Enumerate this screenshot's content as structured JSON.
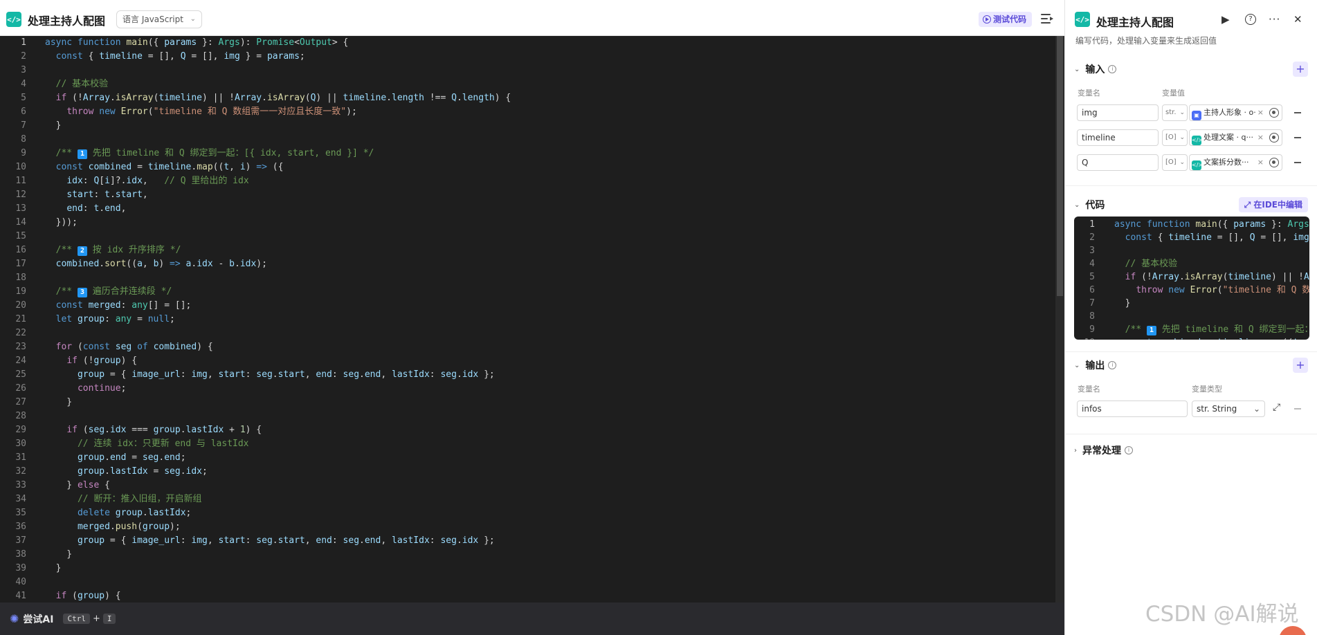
{
  "editor": {
    "title": "处理主持人配图",
    "language_label": "语言 JavaScript",
    "test_button": "测试代码",
    "lines": [
      [
        [
          "k",
          "async "
        ],
        [
          "k",
          "function "
        ],
        [
          "f",
          "main"
        ],
        [
          "p",
          "({ "
        ],
        [
          "v",
          "params "
        ],
        [
          "p",
          "}: "
        ],
        [
          "t",
          "Args"
        ],
        [
          "p",
          "): "
        ],
        [
          "t",
          "Promise"
        ],
        [
          "p",
          "<"
        ],
        [
          "t",
          "Output"
        ],
        [
          "p",
          "> {"
        ]
      ],
      [
        [
          "p",
          "  "
        ],
        [
          "k",
          "const "
        ],
        [
          "p",
          "{ "
        ],
        [
          "v",
          "timeline"
        ],
        [
          "p",
          " = [], "
        ],
        [
          "v",
          "Q"
        ],
        [
          "p",
          " = [], "
        ],
        [
          "v",
          "img "
        ],
        [
          "p",
          "} = "
        ],
        [
          "v",
          "params"
        ],
        [
          "p",
          ";"
        ]
      ],
      [
        [
          "p",
          ""
        ]
      ],
      [
        [
          "p",
          "  "
        ],
        [
          "c",
          "// 基本校验"
        ]
      ],
      [
        [
          "p",
          "  "
        ],
        [
          "cf",
          "if "
        ],
        [
          "p",
          "(!"
        ],
        [
          "v",
          "Array"
        ],
        [
          "p",
          "."
        ],
        [
          "f",
          "isArray"
        ],
        [
          "p",
          "("
        ],
        [
          "v",
          "timeline"
        ],
        [
          "p",
          ") || !"
        ],
        [
          "v",
          "Array"
        ],
        [
          "p",
          "."
        ],
        [
          "f",
          "isArray"
        ],
        [
          "p",
          "("
        ],
        [
          "v",
          "Q"
        ],
        [
          "p",
          ") || "
        ],
        [
          "v",
          "timeline"
        ],
        [
          "p",
          "."
        ],
        [
          "v",
          "length "
        ],
        [
          "p",
          "!== "
        ],
        [
          "v",
          "Q"
        ],
        [
          "p",
          "."
        ],
        [
          "v",
          "length"
        ],
        [
          "p",
          ") {"
        ]
      ],
      [
        [
          "p",
          "    "
        ],
        [
          "cf",
          "throw "
        ],
        [
          "k",
          "new "
        ],
        [
          "f",
          "Error"
        ],
        [
          "p",
          "("
        ],
        [
          "s",
          "\"timeline 和 Q 数组需一一对应且长度一致\""
        ],
        [
          "p",
          ");"
        ]
      ],
      [
        [
          "p",
          "  }"
        ]
      ],
      [
        [
          "p",
          ""
        ]
      ],
      [
        [
          "p",
          "  "
        ],
        [
          "c",
          "/** "
        ],
        [
          "e",
          "1"
        ],
        [
          "c",
          " 先把 timeline 和 Q 绑定到一起：[{ idx, start, end }] */"
        ]
      ],
      [
        [
          "p",
          "  "
        ],
        [
          "k",
          "const "
        ],
        [
          "v",
          "combined"
        ],
        [
          "p",
          " = "
        ],
        [
          "v",
          "timeline"
        ],
        [
          "p",
          "."
        ],
        [
          "f",
          "map"
        ],
        [
          "p",
          "(("
        ],
        [
          "v",
          "t"
        ],
        [
          "p",
          ", "
        ],
        [
          "v",
          "i"
        ],
        [
          "p",
          ") "
        ],
        [
          "k",
          "=>"
        ],
        [
          "p",
          " ({"
        ]
      ],
      [
        [
          "p",
          "    "
        ],
        [
          "v",
          "idx"
        ],
        [
          "p",
          ": "
        ],
        [
          "v",
          "Q"
        ],
        [
          "p",
          "["
        ],
        [
          "v",
          "i"
        ],
        [
          "p",
          "]?."
        ],
        [
          "v",
          "idx"
        ],
        [
          "p",
          ",   "
        ],
        [
          "c",
          "// Q 里给出的 idx"
        ]
      ],
      [
        [
          "p",
          "    "
        ],
        [
          "v",
          "start"
        ],
        [
          "p",
          ": "
        ],
        [
          "v",
          "t"
        ],
        [
          "p",
          "."
        ],
        [
          "v",
          "start"
        ],
        [
          "p",
          ","
        ]
      ],
      [
        [
          "p",
          "    "
        ],
        [
          "v",
          "end"
        ],
        [
          "p",
          ": "
        ],
        [
          "v",
          "t"
        ],
        [
          "p",
          "."
        ],
        [
          "v",
          "end"
        ],
        [
          "p",
          ","
        ]
      ],
      [
        [
          "p",
          "  }));"
        ]
      ],
      [
        [
          "p",
          ""
        ]
      ],
      [
        [
          "p",
          "  "
        ],
        [
          "c",
          "/** "
        ],
        [
          "e",
          "2"
        ],
        [
          "c",
          " 按 idx 升序排序 */"
        ]
      ],
      [
        [
          "p",
          "  "
        ],
        [
          "v",
          "combined"
        ],
        [
          "p",
          "."
        ],
        [
          "f",
          "sort"
        ],
        [
          "p",
          "(("
        ],
        [
          "v",
          "a"
        ],
        [
          "p",
          ", "
        ],
        [
          "v",
          "b"
        ],
        [
          "p",
          ") "
        ],
        [
          "k",
          "=>"
        ],
        [
          "p",
          " "
        ],
        [
          "v",
          "a"
        ],
        [
          "p",
          "."
        ],
        [
          "v",
          "idx"
        ],
        [
          "p",
          " - "
        ],
        [
          "v",
          "b"
        ],
        [
          "p",
          "."
        ],
        [
          "v",
          "idx"
        ],
        [
          "p",
          ");"
        ]
      ],
      [
        [
          "p",
          ""
        ]
      ],
      [
        [
          "p",
          "  "
        ],
        [
          "c",
          "/** "
        ],
        [
          "e",
          "3"
        ],
        [
          "c",
          " 遍历合并连续段 */"
        ]
      ],
      [
        [
          "p",
          "  "
        ],
        [
          "k",
          "const "
        ],
        [
          "v",
          "merged"
        ],
        [
          "p",
          ": "
        ],
        [
          "t",
          "any"
        ],
        [
          "p",
          "[] = [];"
        ]
      ],
      [
        [
          "p",
          "  "
        ],
        [
          "k",
          "let "
        ],
        [
          "v",
          "group"
        ],
        [
          "p",
          ": "
        ],
        [
          "t",
          "any"
        ],
        [
          "p",
          " = "
        ],
        [
          "k",
          "null"
        ],
        [
          "p",
          ";"
        ]
      ],
      [
        [
          "p",
          ""
        ]
      ],
      [
        [
          "p",
          "  "
        ],
        [
          "cf",
          "for "
        ],
        [
          "p",
          "("
        ],
        [
          "k",
          "const "
        ],
        [
          "v",
          "seg "
        ],
        [
          "k",
          "of "
        ],
        [
          "v",
          "combined"
        ],
        [
          "p",
          ") {"
        ]
      ],
      [
        [
          "p",
          "    "
        ],
        [
          "cf",
          "if "
        ],
        [
          "p",
          "(!"
        ],
        [
          "v",
          "group"
        ],
        [
          "p",
          ") {"
        ]
      ],
      [
        [
          "p",
          "      "
        ],
        [
          "v",
          "group"
        ],
        [
          "p",
          " = { "
        ],
        [
          "v",
          "image_url"
        ],
        [
          "p",
          ": "
        ],
        [
          "v",
          "img"
        ],
        [
          "p",
          ", "
        ],
        [
          "v",
          "start"
        ],
        [
          "p",
          ": "
        ],
        [
          "v",
          "seg"
        ],
        [
          "p",
          "."
        ],
        [
          "v",
          "start"
        ],
        [
          "p",
          ", "
        ],
        [
          "v",
          "end"
        ],
        [
          "p",
          ": "
        ],
        [
          "v",
          "seg"
        ],
        [
          "p",
          "."
        ],
        [
          "v",
          "end"
        ],
        [
          "p",
          ", "
        ],
        [
          "v",
          "lastIdx"
        ],
        [
          "p",
          ": "
        ],
        [
          "v",
          "seg"
        ],
        [
          "p",
          "."
        ],
        [
          "v",
          "idx"
        ],
        [
          "p",
          " };"
        ]
      ],
      [
        [
          "p",
          "      "
        ],
        [
          "cf",
          "continue"
        ],
        [
          "p",
          ";"
        ]
      ],
      [
        [
          "p",
          "    }"
        ]
      ],
      [
        [
          "p",
          ""
        ]
      ],
      [
        [
          "p",
          "    "
        ],
        [
          "cf",
          "if "
        ],
        [
          "p",
          "("
        ],
        [
          "v",
          "seg"
        ],
        [
          "p",
          "."
        ],
        [
          "v",
          "idx"
        ],
        [
          "p",
          " === "
        ],
        [
          "v",
          "group"
        ],
        [
          "p",
          "."
        ],
        [
          "v",
          "lastIdx"
        ],
        [
          "p",
          " + "
        ],
        [
          "n",
          "1"
        ],
        [
          "p",
          ") {"
        ]
      ],
      [
        [
          "p",
          "      "
        ],
        [
          "c",
          "// 连续 idx：只更新 end 与 lastIdx"
        ]
      ],
      [
        [
          "p",
          "      "
        ],
        [
          "v",
          "group"
        ],
        [
          "p",
          "."
        ],
        [
          "v",
          "end"
        ],
        [
          "p",
          " = "
        ],
        [
          "v",
          "seg"
        ],
        [
          "p",
          "."
        ],
        [
          "v",
          "end"
        ],
        [
          "p",
          ";"
        ]
      ],
      [
        [
          "p",
          "      "
        ],
        [
          "v",
          "group"
        ],
        [
          "p",
          "."
        ],
        [
          "v",
          "lastIdx"
        ],
        [
          "p",
          " = "
        ],
        [
          "v",
          "seg"
        ],
        [
          "p",
          "."
        ],
        [
          "v",
          "idx"
        ],
        [
          "p",
          ";"
        ]
      ],
      [
        [
          "p",
          "    } "
        ],
        [
          "cf",
          "else "
        ],
        [
          "p",
          "{"
        ]
      ],
      [
        [
          "p",
          "      "
        ],
        [
          "c",
          "// 断开：推入旧组，开启新组"
        ]
      ],
      [
        [
          "p",
          "      "
        ],
        [
          "k",
          "delete "
        ],
        [
          "v",
          "group"
        ],
        [
          "p",
          "."
        ],
        [
          "v",
          "lastIdx"
        ],
        [
          "p",
          ";"
        ]
      ],
      [
        [
          "p",
          "      "
        ],
        [
          "v",
          "merged"
        ],
        [
          "p",
          "."
        ],
        [
          "f",
          "push"
        ],
        [
          "p",
          "("
        ],
        [
          "v",
          "group"
        ],
        [
          "p",
          ");"
        ]
      ],
      [
        [
          "p",
          "      "
        ],
        [
          "v",
          "group"
        ],
        [
          "p",
          " = { "
        ],
        [
          "v",
          "image_url"
        ],
        [
          "p",
          ": "
        ],
        [
          "v",
          "img"
        ],
        [
          "p",
          ", "
        ],
        [
          "v",
          "start"
        ],
        [
          "p",
          ": "
        ],
        [
          "v",
          "seg"
        ],
        [
          "p",
          "."
        ],
        [
          "v",
          "start"
        ],
        [
          "p",
          ", "
        ],
        [
          "v",
          "end"
        ],
        [
          "p",
          ": "
        ],
        [
          "v",
          "seg"
        ],
        [
          "p",
          "."
        ],
        [
          "v",
          "end"
        ],
        [
          "p",
          ", "
        ],
        [
          "v",
          "lastIdx"
        ],
        [
          "p",
          ": "
        ],
        [
          "v",
          "seg"
        ],
        [
          "p",
          "."
        ],
        [
          "v",
          "idx"
        ],
        [
          "p",
          " };"
        ]
      ],
      [
        [
          "p",
          "    }"
        ]
      ],
      [
        [
          "p",
          "  }"
        ]
      ],
      [
        [
          "p",
          ""
        ]
      ],
      [
        [
          "p",
          "  "
        ],
        [
          "cf",
          "if "
        ],
        [
          "p",
          "("
        ],
        [
          "v",
          "group"
        ],
        [
          "p",
          ") {"
        ]
      ]
    ],
    "try_ai": "尝试AI",
    "kbd_ctrl": "Ctrl",
    "kbd_plus": "+",
    "kbd_i": "I"
  },
  "panel": {
    "title": "处理主持人配图",
    "subtitle": "编写代码，处理输入变量来生成返回值",
    "input_section": "输入",
    "col_var_name": "变量名",
    "col_var_value": "变量值",
    "inputs": [
      {
        "name": "img",
        "type": "str.",
        "ref_label": "主持人形象 · o·",
        "ref_color": "#4c6ef5"
      },
      {
        "name": "timeline",
        "type": "[O]",
        "ref_label": "处理文案 · q···",
        "ref_color": "#14b8a6"
      },
      {
        "name": "Q",
        "type": "[O]",
        "ref_label": "文案拆分数···",
        "ref_color": "#14b8a6"
      }
    ],
    "code_section": "代码",
    "ide_button": "在IDE中编辑",
    "output_section": "输出",
    "col_out_name": "变量名",
    "col_out_type": "变量类型",
    "output_name": "infos",
    "output_type": "str. String",
    "exception_section": "异常处理"
  },
  "watermark": "CSDN @AI解说",
  "colors": {
    "accent": "#5b4bd8",
    "accent_bg": "#ebe8ff",
    "node_icon": "#14b8a6",
    "editor_bg": "#1e1e1e"
  }
}
